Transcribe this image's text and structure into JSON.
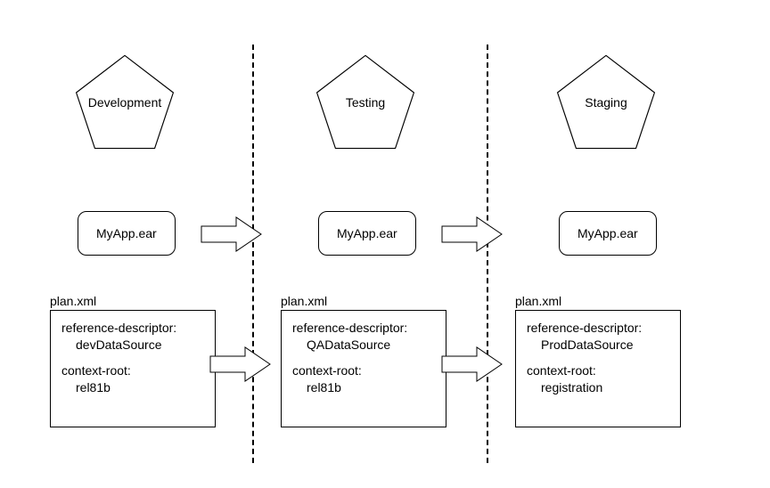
{
  "environments": [
    {
      "name": "Development",
      "ear_label": "MyApp.ear",
      "plan_label": "plan.xml",
      "refdesc_key": "reference-descriptor:",
      "refdesc_val": "devDataSource",
      "ctx_key": "context-root:",
      "ctx_val": "rel81b"
    },
    {
      "name": "Testing",
      "ear_label": "MyApp.ear",
      "plan_label": "plan.xml",
      "refdesc_key": "reference-descriptor:",
      "refdesc_val": "QADataSource",
      "ctx_key": "context-root:",
      "ctx_val": "rel81b"
    },
    {
      "name": "Staging",
      "ear_label": "MyApp.ear",
      "plan_label": "plan.xml",
      "refdesc_key": "reference-descriptor:",
      "refdesc_val": "ProdDataSource",
      "ctx_key": "context-root:",
      "ctx_val": "registration"
    }
  ]
}
